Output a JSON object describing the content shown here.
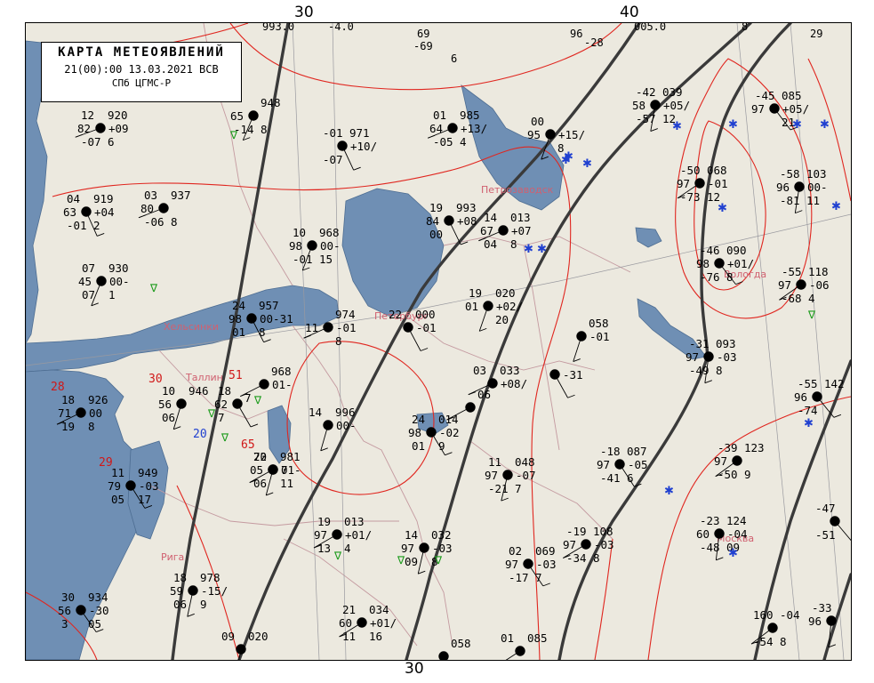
{
  "header": {
    "title": "КАРТА МЕТЕОЯВЛЕНИЙ",
    "datetime": "21(00):00 13.03.2021 ВСВ",
    "source": "СПб ЦГМС-Р"
  },
  "longitude_labels": {
    "top_left": "30",
    "top_right": "40",
    "bottom": "30"
  },
  "colors": {
    "land": "#ece9df",
    "water": "#6f8fb4",
    "isobar": "#e0261f",
    "front": "#3a3a3a",
    "border": "#c49aa0",
    "city": "#d06070",
    "precip_green": "#1a9a1a",
    "snow_blue": "#2040d0"
  },
  "cities": {
    "petrozavodsk": "Петрозаводск",
    "peterburg": "Петербург",
    "helsinki": "Хельсинки",
    "tallinn": "Таллин",
    "riga": "Рига",
    "vologda": "Вологда",
    "moskva": "Москва"
  },
  "isobar_labels": [
    "28",
    "30",
    "29",
    "51",
    "65"
  ],
  "blue_labels": [
    "20"
  ],
  "top_edge_values": [
    "993.0",
    "-4.0",
    "69",
    "-69",
    "6",
    "96",
    "-28",
    "005.0",
    "8",
    "29"
  ],
  "stations": [
    {
      "id": "s01",
      "tl": "12",
      "tr": "920",
      "ml": "82",
      "mr": "+09",
      "bl": "-07",
      "br": "6"
    },
    {
      "id": "s02",
      "tl": "",
      "tr": "948",
      "ml": "65",
      "mr": "",
      "bl": "-14",
      "br": "8"
    },
    {
      "id": "s03",
      "tl": "04",
      "tr": "919",
      "ml": "63",
      "mr": "+04",
      "bl": "-01",
      "br": "2"
    },
    {
      "id": "s04",
      "tl": "03",
      "tr": "937",
      "ml": "80",
      "mr": "",
      "bl": "-06",
      "br": "8"
    },
    {
      "id": "s05",
      "tl": "07",
      "tr": "930",
      "ml": "45",
      "mr": "00-",
      "bl": "07",
      "br": "1"
    },
    {
      "id": "s06",
      "tl": "-01",
      "tr": "971",
      "ml": "",
      "mr": "+10/",
      "bl": "-07",
      "br": ""
    },
    {
      "id": "s07",
      "tl": "01",
      "tr": "985",
      "ml": "64",
      "mr": "+13/",
      "bl": "-05",
      "br": "4"
    },
    {
      "id": "s08",
      "tl": "10",
      "tr": "968",
      "ml": "98",
      "mr": "00-",
      "bl": "-01",
      "br": "15"
    },
    {
      "id": "s09",
      "tl": "19",
      "tr": "993",
      "ml": "84",
      "mr": "+08",
      "bl": "00",
      "br": ""
    },
    {
      "id": "s10",
      "tl": "14",
      "tr": "013",
      "ml": "67",
      "mr": "+07",
      "bl": "04",
      "br": "8"
    },
    {
      "id": "s11",
      "tl": "00",
      "tr": "",
      "ml": "95",
      "mr": "+15/",
      "bl": "",
      "br": "8"
    },
    {
      "id": "s12",
      "tl": "24",
      "tr": "957",
      "ml": "98",
      "mr": "00-31",
      "bl": "01",
      "br": "8"
    },
    {
      "id": "s13",
      "tl": "",
      "tr": "974",
      "ml": "11",
      "mr": "-01",
      "bl": "",
      "br": "8"
    },
    {
      "id": "s14",
      "tl": "19",
      "tr": "020",
      "ml": "01",
      "mr": "+02/",
      "bl": "",
      "br": "20"
    },
    {
      "id": "s15",
      "tl": "22",
      "tr": "000",
      "ml": "",
      "mr": "-01",
      "bl": "",
      "br": ""
    },
    {
      "id": "s16",
      "tl": "03",
      "tr": "033",
      "ml": "",
      "mr": "+08/",
      "bl": "",
      "br": ""
    },
    {
      "id": "s17",
      "tl": "",
      "tr": "058",
      "ml": "",
      "mr": "-01",
      "bl": "",
      "br": ""
    },
    {
      "id": "s18",
      "tl": "",
      "tr": "",
      "ml": "",
      "mr": "-31",
      "bl": "",
      "br": ""
    },
    {
      "id": "s19",
      "tl": "18",
      "tr": "926",
      "ml": "71",
      "mr": "00",
      "bl": "19",
      "br": "8"
    },
    {
      "id": "s20",
      "tl": "10",
      "tr": "946",
      "ml": "56",
      "mr": "",
      "bl": "06",
      "br": ""
    },
    {
      "id": "s21",
      "tl": "18",
      "tr": "",
      "ml": "62",
      "mr": "",
      "bl": "7",
      "br": ""
    },
    {
      "id": "s22",
      "tl": "",
      "tr": "968",
      "ml": "",
      "mr": "01-",
      "bl": "7",
      "br": ""
    },
    {
      "id": "s23",
      "tl": "14",
      "tr": "996",
      "ml": "",
      "mr": "00-",
      "bl": "",
      "br": ""
    },
    {
      "id": "s24",
      "tl": "24",
      "tr": "014",
      "ml": "98",
      "mr": "-02",
      "bl": "01",
      "br": "9"
    },
    {
      "id": "s25",
      "tl": "",
      "tr": "06",
      "ml": "",
      "mr": "",
      "bl": "",
      "br": ""
    },
    {
      "id": "s26",
      "tl": "22",
      "tr": "981",
      "ml": "",
      "mr": "01-",
      "bl": "06",
      "br": ""
    },
    {
      "id": "s27",
      "tl": "11",
      "tr": "949",
      "ml": "79",
      "mr": "-03",
      "bl": "05",
      "br": "17"
    },
    {
      "id": "s28",
      "tl": "70",
      "tr": "",
      "ml": "05",
      "mr": "7",
      "bl": "",
      "br": "11"
    },
    {
      "id": "s29",
      "tl": "11",
      "tr": "048",
      "ml": "97",
      "mr": "-07",
      "bl": "-21",
      "br": "7"
    },
    {
      "id": "s30",
      "tl": "-18",
      "tr": "087",
      "ml": "97",
      "mr": "-05",
      "bl": "-41",
      "br": "6"
    },
    {
      "id": "s31",
      "tl": "19",
      "tr": "013",
      "ml": "97",
      "mr": "+01/",
      "bl": "13",
      "br": "4"
    },
    {
      "id": "s32",
      "tl": "14",
      "tr": "032",
      "ml": "97",
      "mr": "-03",
      "bl": "09",
      "br": "8"
    },
    {
      "id": "s33",
      "tl": "02",
      "tr": "069",
      "ml": "97",
      "mr": "-03",
      "bl": "-17",
      "br": "7"
    },
    {
      "id": "s34",
      "tl": "-19",
      "tr": "108",
      "ml": "97",
      "mr": "-03",
      "bl": "-34",
      "br": "8"
    },
    {
      "id": "s35",
      "tl": "18",
      "tr": "978",
      "ml": "59",
      "mr": "-15/",
      "bl": "06",
      "br": "9"
    },
    {
      "id": "s36",
      "tl": "30",
      "tr": "934",
      "ml": "56",
      "mr": "-30",
      "bl": "3",
      "br": "05"
    },
    {
      "id": "s37",
      "tl": "21",
      "tr": "034",
      "ml": "60",
      "mr": "+01/",
      "bl": "11",
      "br": "16"
    },
    {
      "id": "s38",
      "tl": "09",
      "tr": "020",
      "ml": "",
      "mr": "",
      "bl": "",
      "br": ""
    },
    {
      "id": "s39",
      "tl": "",
      "tr": "058",
      "ml": "",
      "mr": "",
      "bl": "",
      "br": ""
    },
    {
      "id": "s40",
      "tl": "01",
      "tr": "085",
      "ml": "",
      "mr": "",
      "bl": "",
      "br": ""
    },
    {
      "id": "s41",
      "tl": "-42",
      "tr": "039",
      "ml": "58",
      "mr": "+05/",
      "bl": "-57",
      "br": "12"
    },
    {
      "id": "s42",
      "tl": "-45",
      "tr": "085",
      "ml": "97",
      "mr": "+05/",
      "bl": "",
      "br": "21"
    },
    {
      "id": "s43",
      "tl": "-50",
      "tr": "068",
      "ml": "97",
      "mr": "-01",
      "bl": "-73",
      "br": "12"
    },
    {
      "id": "s44",
      "tl": "-58",
      "tr": "103",
      "ml": "96",
      "mr": "00-",
      "bl": "-81",
      "br": "11"
    },
    {
      "id": "s45",
      "tl": "-46",
      "tr": "090",
      "ml": "98",
      "mr": "+01/",
      "bl": "-76",
      "br": "8"
    },
    {
      "id": "s46",
      "tl": "-55",
      "tr": "118",
      "ml": "97",
      "mr": "-06",
      "bl": "-68",
      "br": "4"
    },
    {
      "id": "s47",
      "tl": "-31",
      "tr": "093",
      "ml": "97",
      "mr": "-03",
      "bl": "-49",
      "br": "8"
    },
    {
      "id": "s48",
      "tl": "-55",
      "tr": "142",
      "ml": "96",
      "mr": "",
      "bl": "-74",
      "br": ""
    },
    {
      "id": "s49",
      "tl": "-39",
      "tr": "123",
      "ml": "97",
      "mr": "",
      "bl": "-50",
      "br": "9"
    },
    {
      "id": "s50",
      "tl": "-23",
      "tr": "124",
      "ml": "60",
      "mr": "-04",
      "bl": "-48",
      "br": "09"
    },
    {
      "id": "s51",
      "tl": "-47",
      "tr": "",
      "ml": "",
      "mr": "",
      "bl": "-51",
      "br": ""
    },
    {
      "id": "s52",
      "tl": "160",
      "tr": "-04",
      "ml": "",
      "mr": "",
      "bl": "-54",
      "br": "8"
    },
    {
      "id": "s53",
      "tl": "-33",
      "tr": "",
      "ml": "96",
      "mr": "",
      "bl": "",
      "br": ""
    }
  ]
}
